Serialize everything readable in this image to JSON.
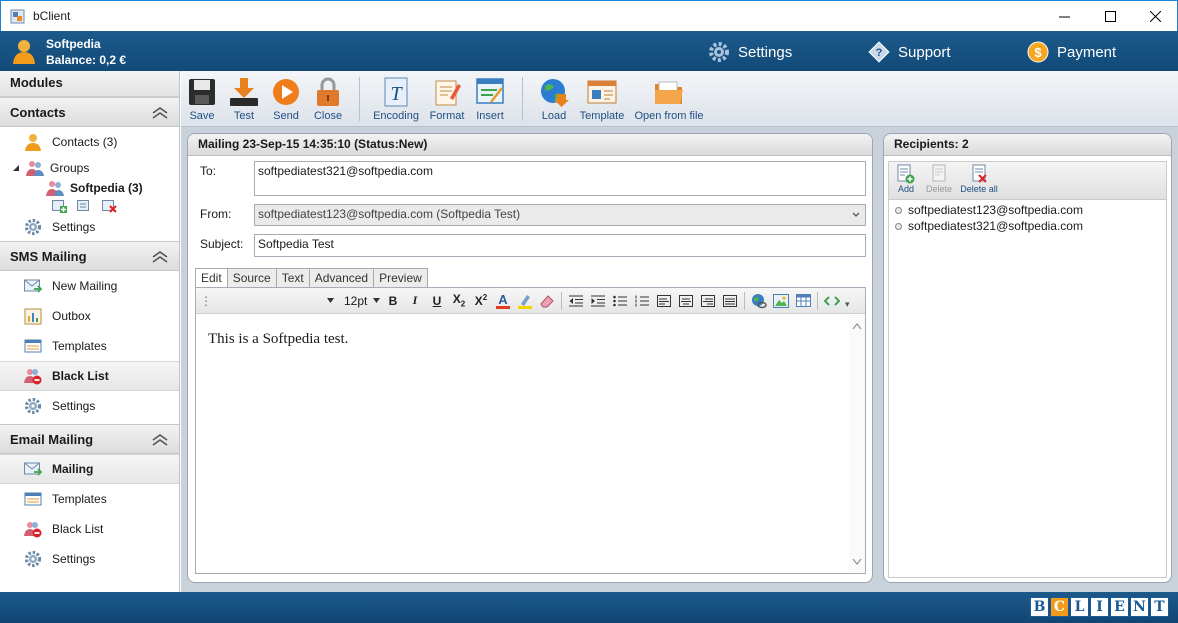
{
  "window": {
    "title": "bClient"
  },
  "header": {
    "user_name": "Softpedia",
    "balance": "Balance: 0,2 €",
    "nav": {
      "settings": "Settings",
      "support": "Support",
      "payment": "Payment"
    }
  },
  "sidebar": {
    "modules_title": "Modules",
    "contacts": {
      "title": "Contacts",
      "contacts_item": "Contacts (3)",
      "groups_item": "Groups",
      "group_softpedia": "Softpedia (3)",
      "settings": "Settings"
    },
    "sms": {
      "title": "SMS Mailing",
      "new_mailing": "New Mailing",
      "outbox": "Outbox",
      "templates": "Templates",
      "black_list": "Black List",
      "settings": "Settings"
    },
    "email": {
      "title": "Email Mailing",
      "mailing": "Mailing",
      "templates": "Templates",
      "black_list": "Black List",
      "settings": "Settings"
    }
  },
  "toolbar": {
    "save": "Save",
    "test": "Test",
    "send": "Send",
    "close": "Close",
    "encoding": "Encoding",
    "format": "Format",
    "insert": "Insert",
    "load": "Load",
    "template": "Template",
    "open_from_file": "Open from file"
  },
  "mailing": {
    "title": "Mailing 23-Sep-15 14:35:10 (Status:New)",
    "to_label": "To:",
    "to_value": "softpediatest321@softpedia.com",
    "from_label": "From:",
    "from_value": "softpediatest123@softpedia.com (Softpedia Test)",
    "subject_label": "Subject:",
    "subject_value": "Softpedia Test",
    "tabs": [
      "Edit",
      "Source",
      "Text",
      "Advanced",
      "Preview"
    ],
    "font_size": "12pt",
    "body": "This is a Softpedia test."
  },
  "recipients": {
    "title": "Recipients: 2",
    "add": "Add",
    "delete": "Delete",
    "delete_all": "Delete all",
    "items": [
      "softpediatest123@softpedia.com",
      "softpediatest321@softpedia.com"
    ]
  },
  "logo_letters": [
    "B",
    "C",
    "L",
    "I",
    "E",
    "N",
    "T"
  ],
  "colors": {
    "header_blue": "#1c5a8c",
    "accent_orange": "#f19a1c",
    "link_blue": "#1f4f84"
  }
}
